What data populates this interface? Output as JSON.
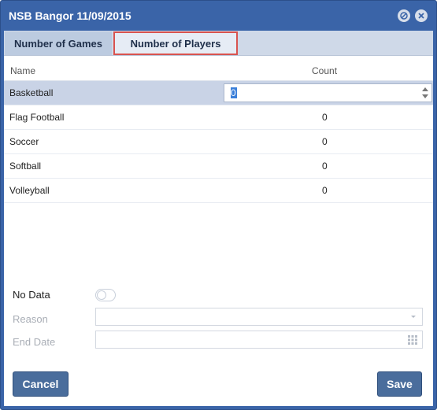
{
  "window": {
    "title": "NSB Bangor 11/09/2015"
  },
  "tabs": [
    {
      "label": "Number of Games"
    },
    {
      "label": "Number of Players"
    }
  ],
  "grid": {
    "columns": {
      "name": "Name",
      "count": "Count"
    },
    "rows": [
      {
        "name": "Basketball",
        "count": "0"
      },
      {
        "name": "Flag Football",
        "count": "0"
      },
      {
        "name": "Soccer",
        "count": "0"
      },
      {
        "name": "Softball",
        "count": "0"
      },
      {
        "name": "Volleyball",
        "count": "0"
      }
    ],
    "editing_value": "0"
  },
  "form": {
    "no_data_label": "No Data",
    "no_data_on": false,
    "reason_label": "Reason",
    "reason_value": "",
    "end_date_label": "End Date",
    "end_date_value": ""
  },
  "buttons": {
    "cancel": "Cancel",
    "save": "Save"
  },
  "colors": {
    "window_blue": "#3a64a8",
    "tab_strip": "#cfd9e8",
    "selected_row": "#c9d3e6",
    "highlight_outline": "#d9534f",
    "button_blue": "#4a6d9c"
  }
}
